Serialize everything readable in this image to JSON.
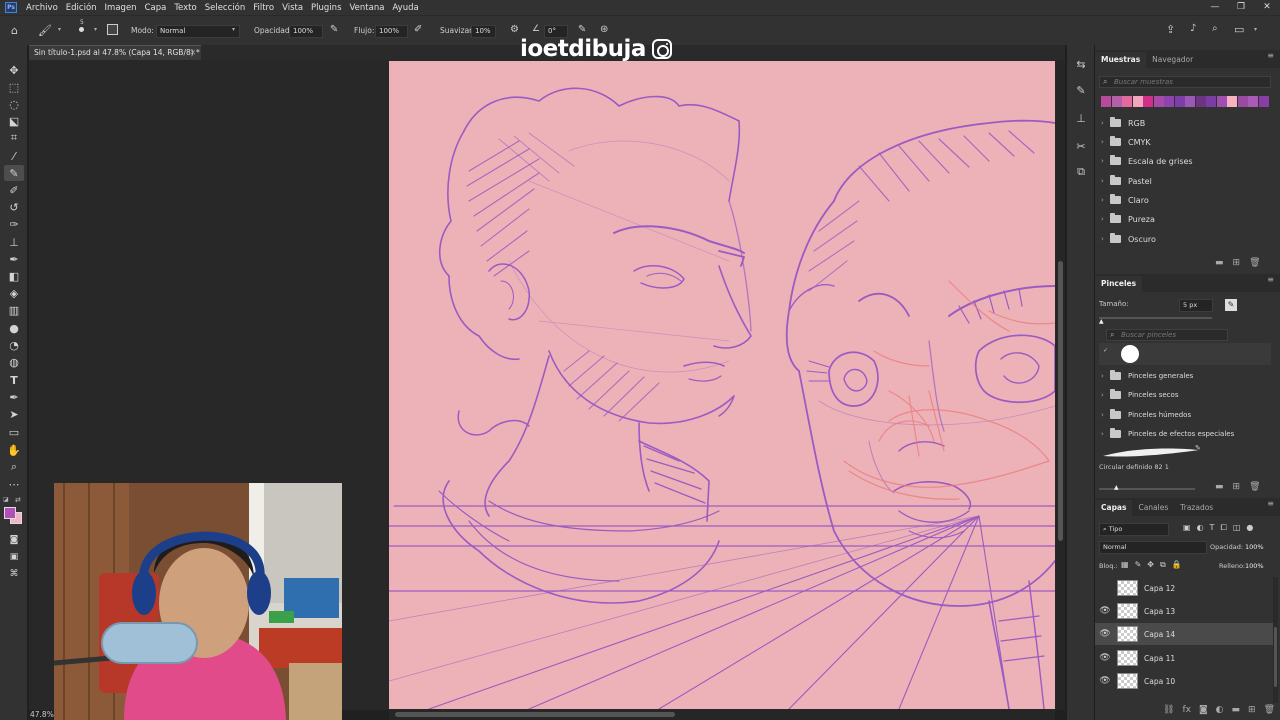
{
  "menubar": {
    "logo": "Ps",
    "items": [
      "Archivo",
      "Edición",
      "Imagen",
      "Capa",
      "Texto",
      "Selección",
      "Filtro",
      "Vista",
      "Plugins",
      "Ventana",
      "Ayuda"
    ]
  },
  "options": {
    "mode_label": "Modo:",
    "mode_value": "Normal",
    "opacity_label": "Opacidad:",
    "opacity_value": "100%",
    "flow_label": "Flujo:",
    "flow_value": "100%",
    "smooth_label": "Suavizar:",
    "smooth_value": "10%",
    "angle_value": "0°",
    "brush_size": "5"
  },
  "document": {
    "tab_title": "Sin título-1.psd al 47.8% (Capa 14, RGB/8) *",
    "zoom": "47.8%",
    "canvas_color": "#edb2b8",
    "stroke_color": "#9b5bc2"
  },
  "watermark": {
    "text": "ioetdibuja",
    "icon": "instagram-icon"
  },
  "swatches": {
    "tabs": [
      "Muestras",
      "Navegador"
    ],
    "search_placeholder": "Buscar muestras",
    "colors": [
      "#b84a9a",
      "#b45fa6",
      "#e26b9b",
      "#f4a6c1",
      "#d0308a",
      "#a64ca6",
      "#8e44ad",
      "#7d3ea8",
      "#9b59b6",
      "#6c3483",
      "#7a3da3",
      "#9f4fb0",
      "#f6b2c0",
      "#9b4aa3",
      "#a85cb5",
      "#8a3ea5"
    ],
    "groups": [
      "RGB",
      "CMYK",
      "Escala de grises",
      "Pastel",
      "Claro",
      "Pureza",
      "Oscuro"
    ]
  },
  "brushes": {
    "title": "Pinceles",
    "size_label": "Tamaño:",
    "size_value": "5 px",
    "search_placeholder": "Buscar pinceles",
    "groups": [
      "Pinceles generales",
      "Pinceles secos",
      "Pinceles húmedos",
      "Pinceles de efectos especiales"
    ],
    "current_brush": "Circular definido 82 1"
  },
  "layers": {
    "tabs": [
      "Capas",
      "Canales",
      "Trazados"
    ],
    "filter_label": "Tipo",
    "blend_mode": "Normal",
    "opacity_label": "Opacidad:",
    "opacity_value": "100%",
    "lock_label": "Bloq.:",
    "fill_label": "Relleno:",
    "fill_value": "100%",
    "items": [
      {
        "name": "Capa 12",
        "visible": false,
        "selected": false
      },
      {
        "name": "Capa 13",
        "visible": true,
        "selected": false
      },
      {
        "name": "Capa 14",
        "visible": true,
        "selected": true
      },
      {
        "name": "Capa 11",
        "visible": true,
        "selected": false
      },
      {
        "name": "Capa 10",
        "visible": true,
        "selected": false
      }
    ]
  },
  "toolbar": {
    "tools": [
      "move-tool",
      "marquee-tool",
      "lasso-tool",
      "object-select-tool",
      "crop-tool",
      "eyedropper-tool",
      "brush-tool",
      "pencil-tool",
      "clone-stamp-tool",
      "healing-tool",
      "history-brush-tool",
      "eraser-tool",
      "paint-bucket-tool",
      "blur-tool",
      "dodge-tool",
      "sponge-tool",
      "type-tool",
      "pen-tool",
      "path-select-tool",
      "rectangle-tool",
      "hand-tool",
      "zoom-tool",
      "more-tools"
    ],
    "foreground": "#b24fb8",
    "background": "#f2b5c8"
  }
}
